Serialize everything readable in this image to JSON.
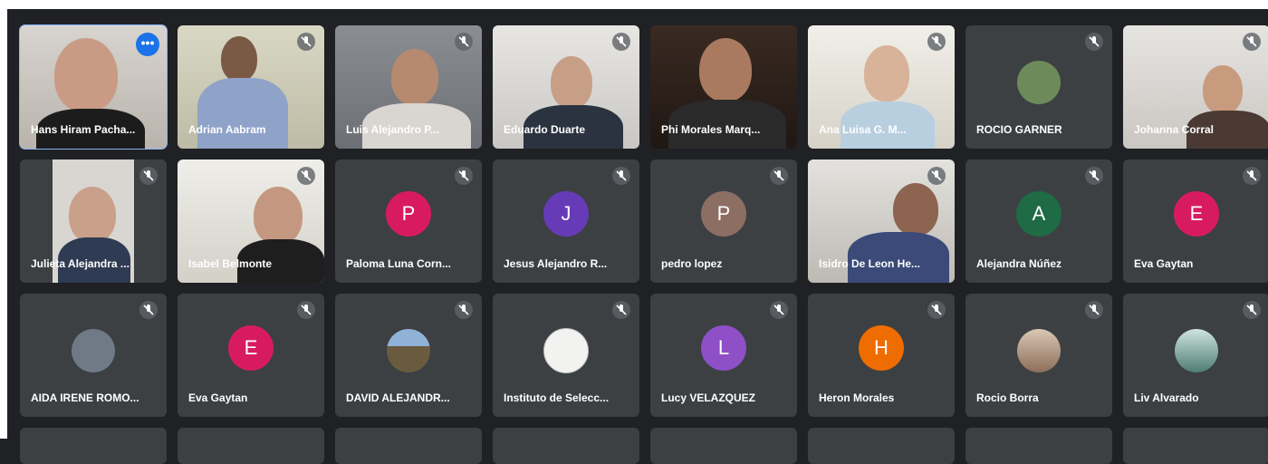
{
  "participants": [
    {
      "name": "Hans Hiram Pacha...",
      "has_more_menu": true
    },
    {
      "name": "Adrian Aabram"
    },
    {
      "name": "Luis Alejandro P..."
    },
    {
      "name": "Eduardo Duarte"
    },
    {
      "name": "Phi Morales Marq..."
    },
    {
      "name": "Ana Luisa G. M..."
    },
    {
      "name": "ROCIO GARNER"
    },
    {
      "name": "Johanna Corral"
    },
    {
      "name": "Julieta Alejandra ..."
    },
    {
      "name": "Isabel Belmonte"
    },
    {
      "name": "Paloma Luna Corn...",
      "initial": "P"
    },
    {
      "name": "Jesus Alejandro R...",
      "initial": "J"
    },
    {
      "name": "pedro lopez",
      "initial": "P"
    },
    {
      "name": "Isidro De Leon He..."
    },
    {
      "name": "Alejandra Núñez",
      "initial": "A"
    },
    {
      "name": "Eva Gaytan",
      "initial": "E"
    },
    {
      "name": "AIDA IRENE ROMO..."
    },
    {
      "name": "Eva Gaytan",
      "initial": "E"
    },
    {
      "name": "DAVID ALEJANDR..."
    },
    {
      "name": "Instituto de Selecc..."
    },
    {
      "name": "Lucy VELAZQUEZ",
      "initial": "L"
    },
    {
      "name": "Heron Morales",
      "initial": "H"
    },
    {
      "name": "Rocio Borra"
    },
    {
      "name": "Liv Alvarado"
    }
  ],
  "more_menu_label": "•••",
  "colors": {
    "tile": "#3c4043",
    "background": "#202124",
    "active_outline": "#8ab4f8",
    "avatar_pink": "#d81b60",
    "avatar_purple": "#673ab7",
    "avatar_brown": "#8d6e63",
    "avatar_green": "#1e6b45",
    "avatar_lilac": "#8e4fc7",
    "avatar_orange": "#ef6c00"
  }
}
